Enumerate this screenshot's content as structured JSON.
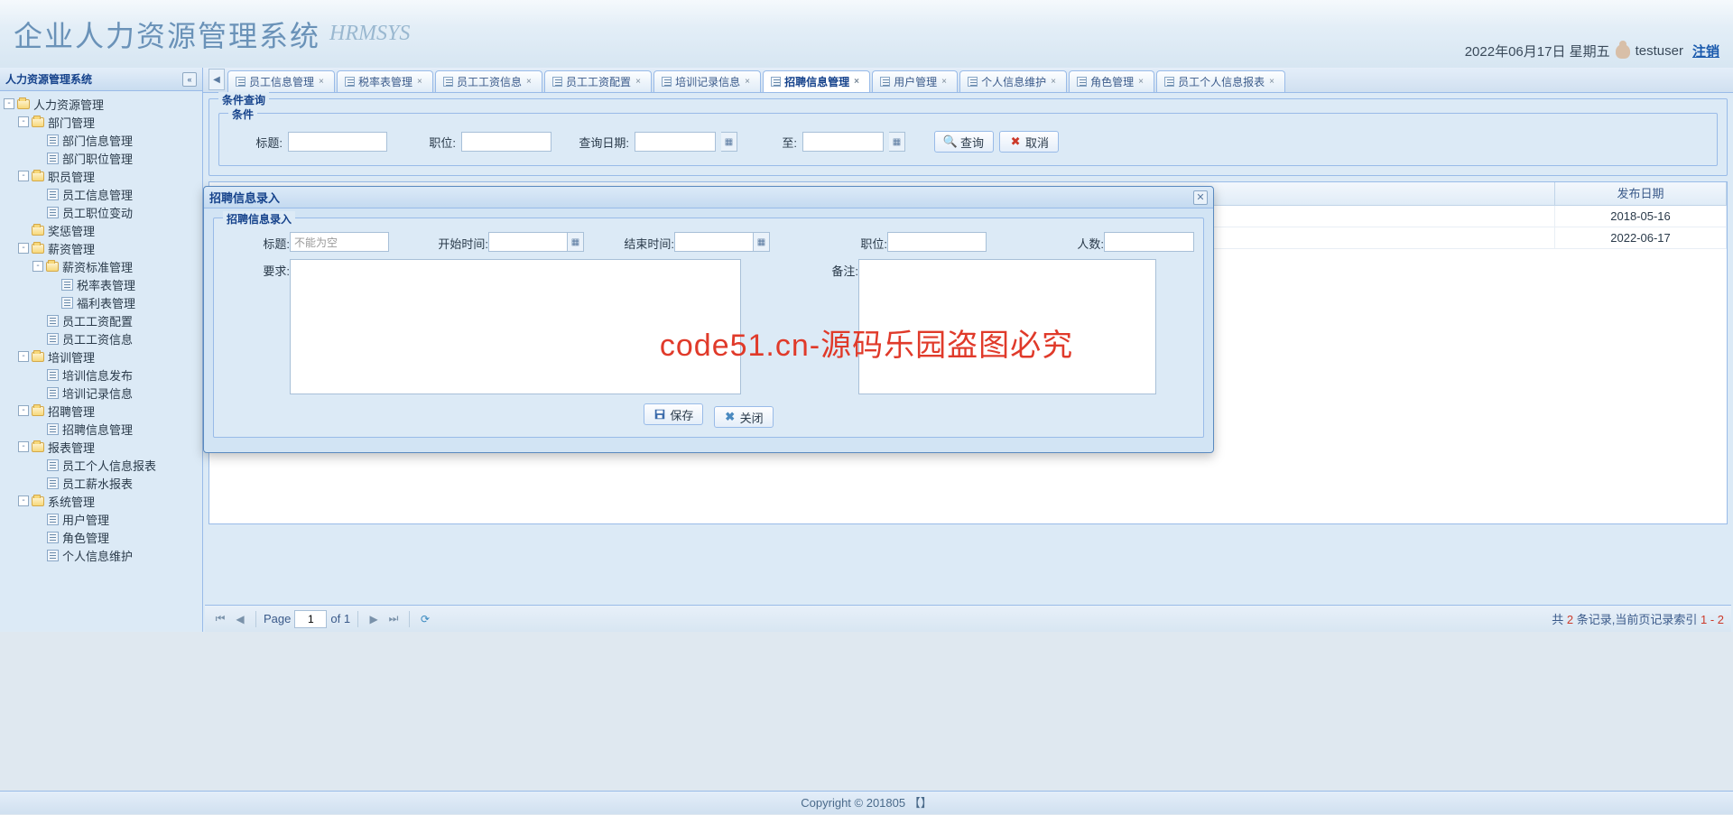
{
  "header": {
    "title": "企业人力资源管理系统",
    "subtitle": "HRMSYS",
    "date": "2022年06月17日 星期五",
    "username": "testuser",
    "logout": "注销"
  },
  "sidebar": {
    "title": "人力资源管理系统",
    "tree": [
      {
        "lvl": 0,
        "exp": "-",
        "type": "folder",
        "label": "人力资源管理"
      },
      {
        "lvl": 1,
        "exp": "-",
        "type": "folder",
        "label": "部门管理"
      },
      {
        "lvl": 2,
        "exp": "",
        "type": "leaf",
        "label": "部门信息管理"
      },
      {
        "lvl": 2,
        "exp": "",
        "type": "leaf",
        "label": "部门职位管理"
      },
      {
        "lvl": 1,
        "exp": "-",
        "type": "folder",
        "label": "职员管理"
      },
      {
        "lvl": 2,
        "exp": "",
        "type": "leaf",
        "label": "员工信息管理"
      },
      {
        "lvl": 2,
        "exp": "",
        "type": "leaf",
        "label": "员工职位变动"
      },
      {
        "lvl": 1,
        "exp": "",
        "type": "folder",
        "label": "奖惩管理"
      },
      {
        "lvl": 1,
        "exp": "-",
        "type": "folder",
        "label": "薪资管理"
      },
      {
        "lvl": 2,
        "exp": "-",
        "type": "folder",
        "label": "薪资标准管理"
      },
      {
        "lvl": 3,
        "exp": "",
        "type": "leaf",
        "label": "税率表管理"
      },
      {
        "lvl": 3,
        "exp": "",
        "type": "leaf",
        "label": "福利表管理"
      },
      {
        "lvl": 2,
        "exp": "",
        "type": "leaf",
        "label": "员工工资配置"
      },
      {
        "lvl": 2,
        "exp": "",
        "type": "leaf",
        "label": "员工工资信息"
      },
      {
        "lvl": 1,
        "exp": "-",
        "type": "folder",
        "label": "培训管理"
      },
      {
        "lvl": 2,
        "exp": "",
        "type": "leaf",
        "label": "培训信息发布"
      },
      {
        "lvl": 2,
        "exp": "",
        "type": "leaf",
        "label": "培训记录信息"
      },
      {
        "lvl": 1,
        "exp": "-",
        "type": "folder",
        "label": "招聘管理"
      },
      {
        "lvl": 2,
        "exp": "",
        "type": "leaf",
        "label": "招聘信息管理"
      },
      {
        "lvl": 1,
        "exp": "-",
        "type": "folder",
        "label": "报表管理"
      },
      {
        "lvl": 2,
        "exp": "",
        "type": "leaf",
        "label": "员工个人信息报表"
      },
      {
        "lvl": 2,
        "exp": "",
        "type": "leaf",
        "label": "员工薪水报表"
      },
      {
        "lvl": 1,
        "exp": "-",
        "type": "folder",
        "label": "系统管理"
      },
      {
        "lvl": 2,
        "exp": "",
        "type": "leaf",
        "label": "用户管理"
      },
      {
        "lvl": 2,
        "exp": "",
        "type": "leaf",
        "label": "角色管理"
      },
      {
        "lvl": 2,
        "exp": "",
        "type": "leaf",
        "label": "个人信息维护"
      }
    ]
  },
  "tabs": [
    {
      "label": "员工信息管理",
      "active": false
    },
    {
      "label": "税率表管理",
      "active": false
    },
    {
      "label": "员工工资信息",
      "active": false
    },
    {
      "label": "员工工资配置",
      "active": false
    },
    {
      "label": "培训记录信息",
      "active": false
    },
    {
      "label": "招聘信息管理",
      "active": true
    },
    {
      "label": "用户管理",
      "active": false
    },
    {
      "label": "个人信息维护",
      "active": false
    },
    {
      "label": "角色管理",
      "active": false
    },
    {
      "label": "员工个人信息报表",
      "active": false
    }
  ],
  "search": {
    "fieldset_title": "条件查询",
    "inner_title": "条件",
    "title_label": "标题:",
    "pos_label": "职位:",
    "date_label": "查询日期:",
    "to_label": "至:",
    "query_btn": "查询",
    "cancel_btn": "取消"
  },
  "grid": {
    "col_date": "发布日期",
    "rows": [
      {
        "date": "2018-05-16"
      },
      {
        "date": "2022-06-17"
      }
    ]
  },
  "paging": {
    "page_label": "Page",
    "page": "1",
    "of": "of 1",
    "summary_prefix": "共 ",
    "summary_count": "2",
    "summary_mid": " 条记录,当前页记录索引 ",
    "summary_range": "1 - 2"
  },
  "modal": {
    "win_title": "招聘信息录入",
    "fs_title": "招聘信息录入",
    "lbl_title": "标题:",
    "title_placeholder": "不能为空",
    "lbl_start": "开始时间:",
    "lbl_end": "结束时间:",
    "lbl_pos": "职位:",
    "lbl_count": "人数:",
    "lbl_req": "要求:",
    "lbl_remark": "备注:",
    "btn_save": "保存",
    "btn_close": "关闭"
  },
  "footer": "Copyright © 201805 【】",
  "watermark": "code51.cn-源码乐园盗图必究"
}
